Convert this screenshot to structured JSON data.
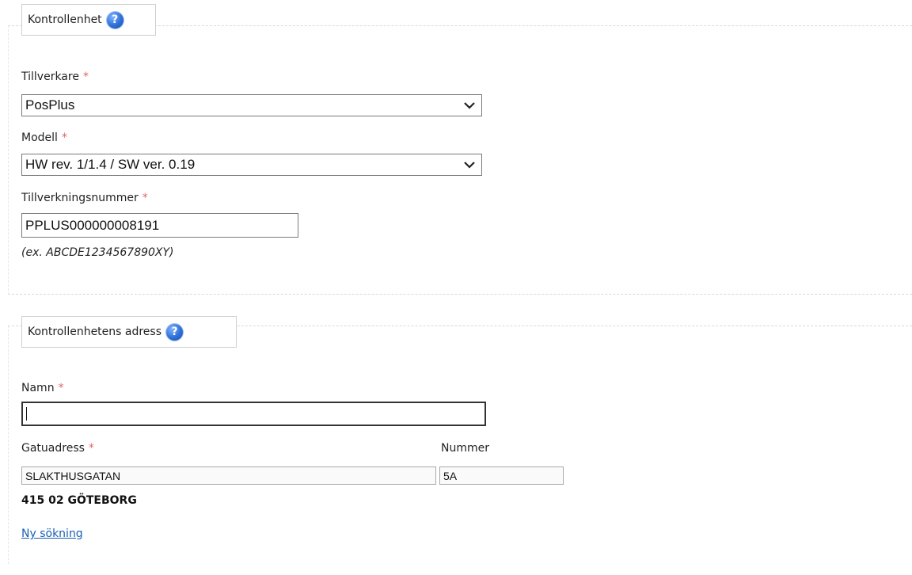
{
  "section1": {
    "legend": "Kontrollenhet",
    "manufacturer": {
      "label": "Tillverkare",
      "required_mark": "*",
      "selected": "PosPlus"
    },
    "model": {
      "label": "Modell",
      "required_mark": "*",
      "selected": "HW rev. 1/1.4 / SW ver. 0.19"
    },
    "serial": {
      "label": "Tillverkningsnummer",
      "required_mark": "*",
      "value": "PPLUS000000008191",
      "hint": "(ex. ABCDE1234567890XY)"
    }
  },
  "section2": {
    "legend": "Kontrollenhetens adress",
    "name": {
      "label": "Namn",
      "required_mark": "*",
      "value": ""
    },
    "street": {
      "label": "Gatuadress",
      "required_mark": "*",
      "value": "SLAKTHUSGATAN"
    },
    "number": {
      "label": "Nummer",
      "value": "5A"
    },
    "postal": "415 02 GÖTEBORG",
    "new_search_link": "Ny sökning"
  },
  "icons": {
    "help": "help-icon",
    "dropdown": "chevron-down-icon"
  },
  "colors": {
    "required": "#e06666",
    "link": "#1a5fb4",
    "help": "#2f6fd6"
  }
}
